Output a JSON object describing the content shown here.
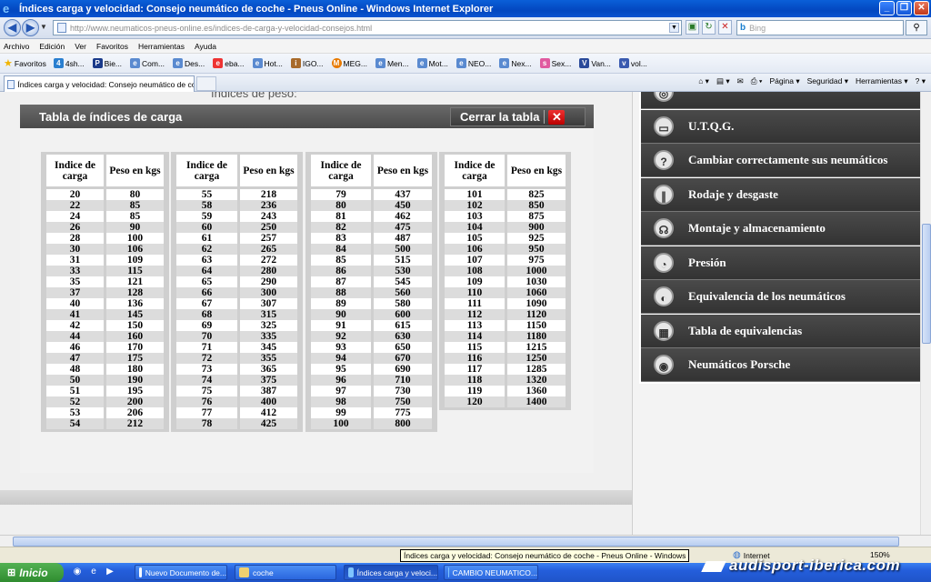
{
  "window": {
    "title": "Índices carga y velocidad: Consejo neumático de coche - Pneus Online - Windows Internet Explorer"
  },
  "address": {
    "url": "http://www.neumaticos-pneus-online.es/indices-de-carga-y-velocidad-consejos.html",
    "search_placeholder": "Bing"
  },
  "menubar": [
    "Archivo",
    "Edición",
    "Ver",
    "Favoritos",
    "Herramientas",
    "Ayuda"
  ],
  "favorites": {
    "label": "Favoritos",
    "items": [
      "4sh...",
      "Bie...",
      "Com...",
      "Des...",
      "eba...",
      "Hot...",
      "IGO...",
      "MEG...",
      "Men...",
      "Mot...",
      "NEO...",
      "Nex...",
      "Sex...",
      "Van...",
      "vol..."
    ]
  },
  "tab": {
    "title": "Índices carga y velocidad: Consejo neumático de coch..."
  },
  "commandbar": [
    "Página ▾",
    "Seguridad ▾",
    "Herramientas ▾"
  ],
  "page": {
    "peso_heading": "índices de peso:",
    "modal": {
      "title": "Tabla de índices de carga",
      "close_label": "Cerrar la tabla",
      "header_index": "Indice de carga",
      "header_weight": "Peso en kgs",
      "tables": [
        {
          "rows": [
            [
              "20",
              "80"
            ],
            [
              "22",
              "85"
            ],
            [
              "24",
              "85"
            ],
            [
              "26",
              "90"
            ],
            [
              "28",
              "100"
            ],
            [
              "30",
              "106"
            ],
            [
              "31",
              "109"
            ],
            [
              "33",
              "115"
            ],
            [
              "35",
              "121"
            ],
            [
              "37",
              "128"
            ],
            [
              "40",
              "136"
            ],
            [
              "41",
              "145"
            ],
            [
              "42",
              "150"
            ],
            [
              "44",
              "160"
            ],
            [
              "46",
              "170"
            ],
            [
              "47",
              "175"
            ],
            [
              "48",
              "180"
            ],
            [
              "50",
              "190"
            ],
            [
              "51",
              "195"
            ],
            [
              "52",
              "200"
            ],
            [
              "53",
              "206"
            ],
            [
              "54",
              "212"
            ]
          ]
        },
        {
          "rows": [
            [
              "55",
              "218"
            ],
            [
              "58",
              "236"
            ],
            [
              "59",
              "243"
            ],
            [
              "60",
              "250"
            ],
            [
              "61",
              "257"
            ],
            [
              "62",
              "265"
            ],
            [
              "63",
              "272"
            ],
            [
              "64",
              "280"
            ],
            [
              "65",
              "290"
            ],
            [
              "66",
              "300"
            ],
            [
              "67",
              "307"
            ],
            [
              "68",
              "315"
            ],
            [
              "69",
              "325"
            ],
            [
              "70",
              "335"
            ],
            [
              "71",
              "345"
            ],
            [
              "72",
              "355"
            ],
            [
              "73",
              "365"
            ],
            [
              "74",
              "375"
            ],
            [
              "75",
              "387"
            ],
            [
              "76",
              "400"
            ],
            [
              "77",
              "412"
            ],
            [
              "78",
              "425"
            ]
          ]
        },
        {
          "rows": [
            [
              "79",
              "437"
            ],
            [
              "80",
              "450"
            ],
            [
              "81",
              "462"
            ],
            [
              "82",
              "475"
            ],
            [
              "83",
              "487"
            ],
            [
              "84",
              "500"
            ],
            [
              "85",
              "515"
            ],
            [
              "86",
              "530"
            ],
            [
              "87",
              "545"
            ],
            [
              "88",
              "560"
            ],
            [
              "89",
              "580"
            ],
            [
              "90",
              "600"
            ],
            [
              "91",
              "615"
            ],
            [
              "92",
              "630"
            ],
            [
              "93",
              "650"
            ],
            [
              "94",
              "670"
            ],
            [
              "95",
              "690"
            ],
            [
              "96",
              "710"
            ],
            [
              "97",
              "730"
            ],
            [
              "98",
              "750"
            ],
            [
              "99",
              "775"
            ],
            [
              "100",
              "800"
            ]
          ]
        },
        {
          "rows": [
            [
              "101",
              "825"
            ],
            [
              "102",
              "850"
            ],
            [
              "103",
              "875"
            ],
            [
              "104",
              "900"
            ],
            [
              "105",
              "925"
            ],
            [
              "106",
              "950"
            ],
            [
              "107",
              "975"
            ],
            [
              "108",
              "1000"
            ],
            [
              "109",
              "1030"
            ],
            [
              "110",
              "1060"
            ],
            [
              "111",
              "1090"
            ],
            [
              "112",
              "1120"
            ],
            [
              "113",
              "1150"
            ],
            [
              "114",
              "1180"
            ],
            [
              "115",
              "1215"
            ],
            [
              "116",
              "1250"
            ],
            [
              "117",
              "1285"
            ],
            [
              "118",
              "1320"
            ],
            [
              "119",
              "1360"
            ],
            [
              "120",
              "1400"
            ]
          ]
        }
      ]
    },
    "sidebar": [
      {
        "label": "U.T.Q.G.",
        "icon": "utqg-icon"
      },
      {
        "label": "Cambiar correctamente sus neumáticos",
        "icon": "question-tire-icon"
      },
      {
        "label": "Rodaje y desgaste",
        "icon": "tread-wear-icon"
      },
      {
        "label": "Montaje y almacenamiento",
        "icon": "mounting-icon"
      },
      {
        "label": "Presión",
        "icon": "pressure-gauge-icon"
      },
      {
        "label": "Equivalencia de los neumáticos",
        "icon": "tire-equivalence-icon"
      },
      {
        "label": "Tabla de equivalencias",
        "icon": "table-icon"
      },
      {
        "label": "Neumáticos Porsche",
        "icon": "porsche-icon"
      }
    ]
  },
  "statusbar": {
    "tooltip": "Índices carga y velocidad: Consejo neumático de coche - Pneus Online - Windows",
    "zone": "Internet",
    "zoom": "150%"
  },
  "taskbar": {
    "start": "Inicio",
    "tasks": [
      "Nuevo Documento de...",
      "coche",
      "Índices carga y veloci...",
      "CAMBIO NEUMATICO..."
    ]
  },
  "watermark": "audisport-iberica.com",
  "colors": {
    "titlebar": "#0347c0",
    "modal_header": "#4b4b4b",
    "sidebar_item": "#333333",
    "close_x": "#dd1111",
    "taskbar": "#245edb",
    "start_button": "#2f8c2f"
  }
}
